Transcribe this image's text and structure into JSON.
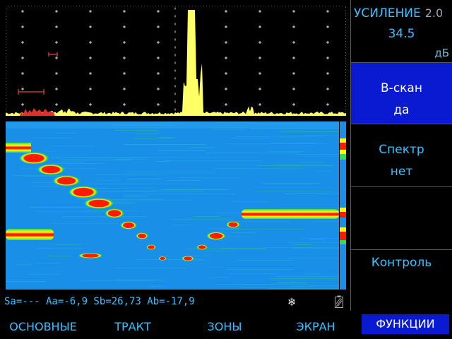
{
  "gain_panel": {
    "title": "УСИЛЕНИЕ",
    "version": "2.0",
    "value": "34.5",
    "unit": "дБ"
  },
  "side_panels": [
    {
      "id": "bscan",
      "label": "B-скан",
      "value": "да",
      "active": true
    },
    {
      "id": "spectr",
      "label": "Спектр",
      "value": "нет",
      "active": false
    },
    {
      "id": "empty",
      "label": "",
      "value": "",
      "active": false
    },
    {
      "id": "control",
      "label": "Контроль",
      "value": "",
      "active": false
    }
  ],
  "status": {
    "text": "Sa=--- Aa=-6,9 Sb=26,73 Ab=-17,9",
    "icons": [
      "snowflake-icon",
      "battery-icon"
    ]
  },
  "tabs": [
    {
      "label": "ОСНОВНЫЕ",
      "active": false
    },
    {
      "label": "ТРАКТ",
      "active": false
    },
    {
      "label": "ЗОНЫ",
      "active": false
    },
    {
      "label": "ЭКРАН",
      "active": false
    },
    {
      "label": "ФУНКЦИИ",
      "active": true
    }
  ],
  "colors": {
    "accent": "#39c0ff",
    "active_bg": "#0a1ad0",
    "ascan_signal": "#ffff66",
    "gate_a": "#cc3333",
    "bscan_bg": "#1a8fe8",
    "bscan_hot": "#ff1a00"
  }
}
